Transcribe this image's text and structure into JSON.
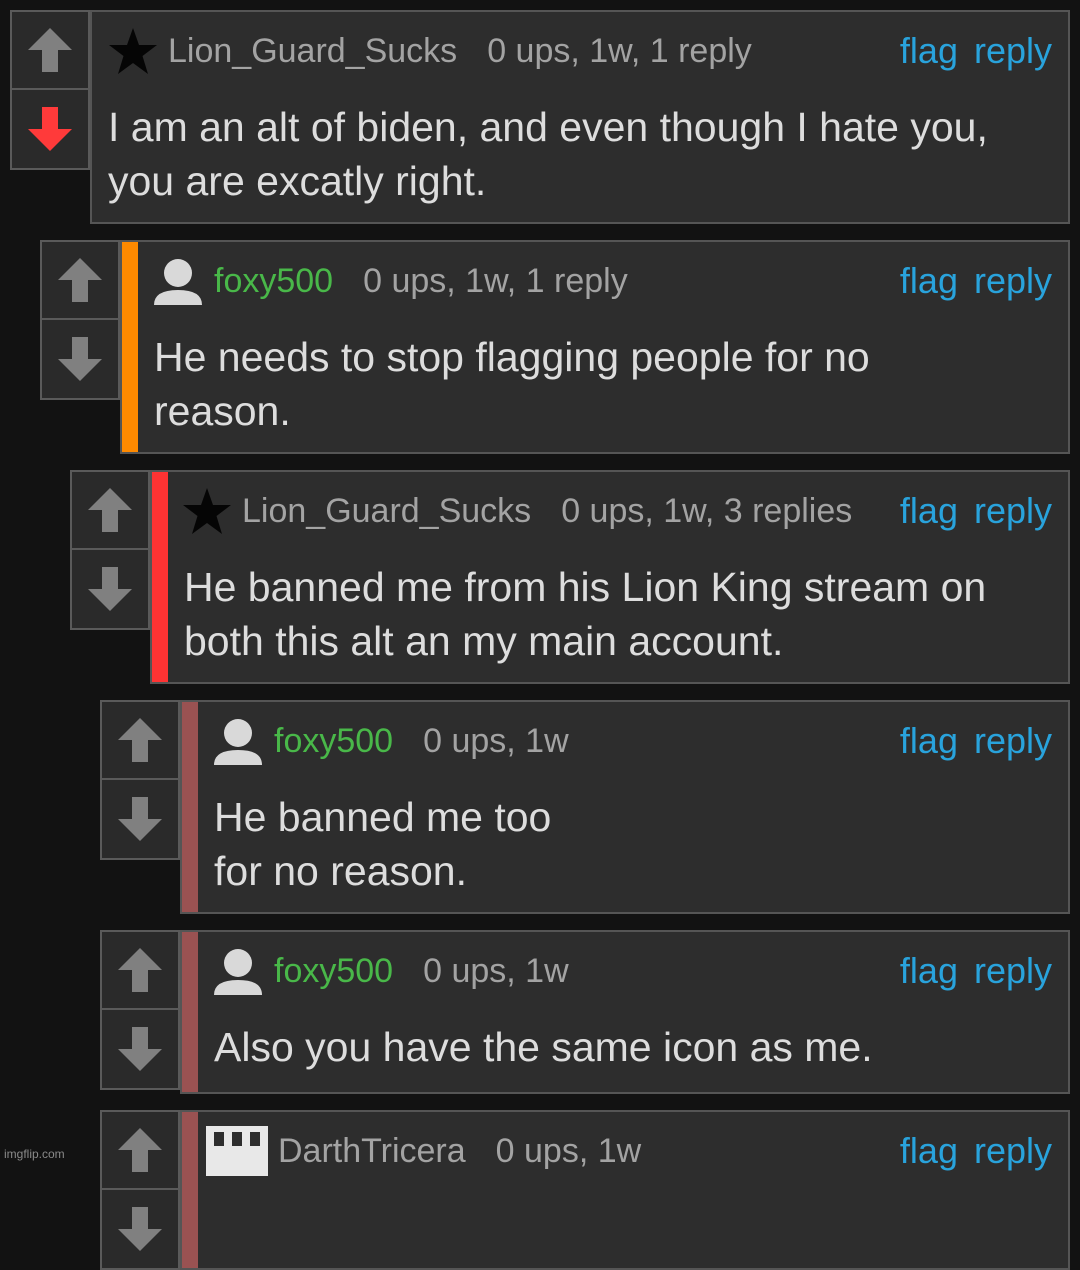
{
  "comments": [
    {
      "username": "Lion_Guard_Sucks",
      "meta": "0 ups, 1w, 1 reply",
      "flag": "flag",
      "reply": "reply",
      "text": "I am an alt of biden, and even though I hate you, you are excatly right.",
      "avatar": "star-icon",
      "downvoted": true
    },
    {
      "username": "foxy500",
      "meta": "0 ups, 1w, 1 reply",
      "flag": "flag",
      "reply": "reply",
      "text": "He needs to stop flagging people for no reason.",
      "avatar": "user-silhouette-icon",
      "bar_color": "#ff8a00"
    },
    {
      "username": "Lion_Guard_Sucks",
      "meta": "0 ups, 1w, 3 replies",
      "flag": "flag",
      "reply": "reply",
      "text": "He banned me from his Lion King stream on both this alt an my main account.",
      "avatar": "star-icon",
      "bar_color": "#ff3333"
    },
    {
      "username": "foxy500",
      "meta": "0 ups, 1w",
      "flag": "flag",
      "reply": "reply",
      "text_line1": "He banned me too",
      "text_line2": "for no reason.",
      "avatar": "user-silhouette-icon",
      "bar_color": "#9a5252"
    },
    {
      "username": "foxy500",
      "meta": "0 ups, 1w",
      "flag": "flag",
      "reply": "reply",
      "text": "Also you have the same icon as me.",
      "avatar": "user-silhouette-icon",
      "bar_color": "#9a5252"
    },
    {
      "username": "DarthTricera",
      "meta": "0 ups, 1w",
      "flag": "flag",
      "reply": "reply",
      "avatar": "pixel-avatar-icon",
      "bar_color": "#9a5252"
    }
  ],
  "watermark": "imgflip.com"
}
